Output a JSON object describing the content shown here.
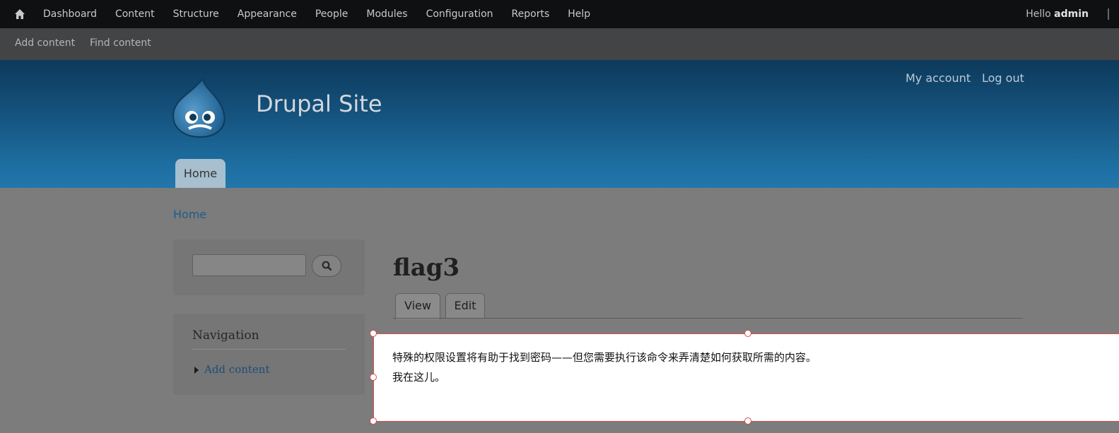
{
  "toolbar": {
    "menu": [
      "Dashboard",
      "Content",
      "Structure",
      "Appearance",
      "People",
      "Modules",
      "Configuration",
      "Reports",
      "Help"
    ],
    "hello_prefix": "Hello",
    "username": "admin"
  },
  "shortcuts": {
    "add_content": "Add content",
    "find_content": "Find content"
  },
  "header": {
    "site_name": "Drupal Site",
    "my_account": "My account",
    "log_out": "Log out",
    "primary_tab": "Home"
  },
  "breadcrumb": "Home",
  "sidebar": {
    "search_value": "",
    "navigation_title": "Navigation",
    "navigation_link": "Add content"
  },
  "content": {
    "title": "flag3",
    "tabs": [
      "View",
      "Edit"
    ],
    "body_line1": "特殊的权限设置将有助于找到密码——但您需要执行该命令来弄清楚如何获取所需的内容。",
    "body_line2": "我在这儿。"
  },
  "colors": {
    "toolbar_bg": "#0f1012",
    "header_blue": "#2277ac",
    "editor_border": "#d84a4a"
  }
}
